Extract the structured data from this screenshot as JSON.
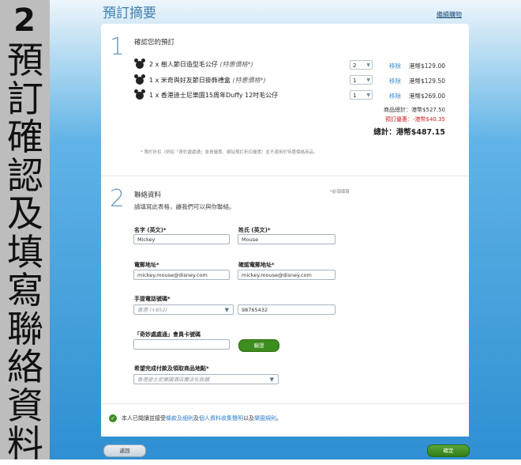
{
  "sidebar": {
    "step_number": "2",
    "step_chars": [
      "預",
      "訂",
      "確",
      "認",
      "及",
      "填",
      "寫",
      "聯",
      "絡",
      "資",
      "料"
    ]
  },
  "header": {
    "title": "預訂摘要",
    "continue_link": "繼續購物"
  },
  "section1": {
    "number": "1",
    "title": "確認您的預訂",
    "products": [
      {
        "name": "2 x 樹人節日造型毛公仔",
        "note": "(特惠價格*)",
        "qty": "2",
        "remove": "移除",
        "price": "港幣$129.00"
      },
      {
        "name": "1 x 米奇與好友節日掛飾禮盒",
        "note": "(特惠價格*)",
        "qty": "1",
        "remove": "移除",
        "price": "港幣$129.50"
      },
      {
        "name": "1 x 香港迪士尼樂園15周年Duffy 12吋毛公仔",
        "note": "",
        "qty": "1",
        "remove": "移除",
        "price": "港幣$269.00"
      }
    ],
    "subtotal": "商品總計：港幣$527.50",
    "discount": "預訂優惠：-港幣$40.35",
    "total": "總計：港幣$487.15",
    "footnote": "* 限於折扣（例如「奇妙處處通」會員優惠、網站預訂折扣優惠）並不適用於特惠價格商品。"
  },
  "section2": {
    "number": "2",
    "title": "聯絡資料",
    "required_note": "*必須填寫",
    "subtext": "請填寫此表格，讓我們可以與你聯絡。",
    "first_name_label": "名字 (英文)*",
    "first_name_value": "Mickey",
    "last_name_label": "姓氏 (英文)*",
    "last_name_value": "Mouse",
    "email_label": "電郵地址*",
    "email_value": "mickey.mouse@disney.com",
    "confirm_email_label": "確認電郵地址*",
    "confirm_email_value": "mickey.mouse@disney.com",
    "phone_label": "手提電話號碼*",
    "phone_country_placeholder": "香港 (+852)",
    "phone_value": "98765432",
    "member_label": "「奇妙處處通」會員卡號碼",
    "member_value": "",
    "verify_button": "驗證",
    "pickup_label": "希望完成付款及領取商品地點*",
    "pickup_placeholder": "香港迪士尼樂園酒店魔法化妝舖"
  },
  "consent": {
    "prefix": "本人已閱讀並接受",
    "link1": "條款及細則",
    "middle": "及",
    "link2": "個人資料收集聲明",
    "middle2": "以及",
    "link3": "樂園規則",
    "suffix": "。"
  },
  "footer": {
    "back_button": "返回",
    "confirm_button": "確定"
  },
  "colors": {
    "accent_blue": "#3a8cd0",
    "confirm_green": "#3d8d1f",
    "discount_red": "#cc2222"
  }
}
